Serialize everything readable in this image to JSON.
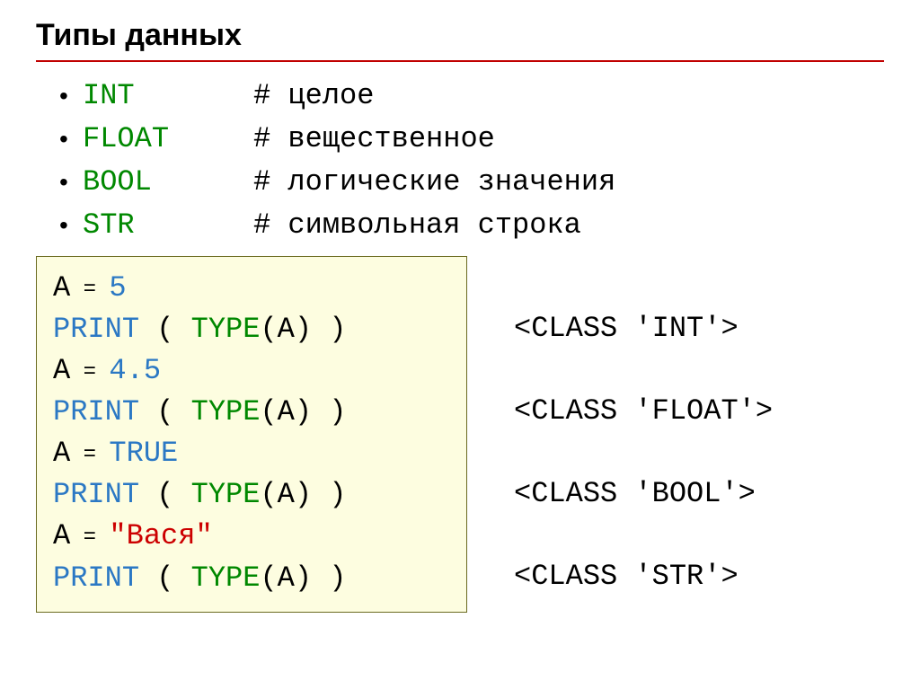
{
  "heading": "Типы данных",
  "types": [
    {
      "name": "INT",
      "comment": "# целое"
    },
    {
      "name": "FLOAT",
      "comment": "# вещественное"
    },
    {
      "name": "BOOL",
      "comment": "# логические значения"
    },
    {
      "name": "STR",
      "comment": "# символьная строка"
    }
  ],
  "code": {
    "assign1_var": "A",
    "assign1_val": "5",
    "print1_call": "PRINT",
    "type_call": "TYPE",
    "arg": "(A)",
    "closeParen": " )",
    "openParen": " ( ",
    "assign2_val": "4.5",
    "assign3_val": "TRUE",
    "assign4_val": "\"Вася\""
  },
  "outputs": {
    "o1": "<CLASS 'INT'>",
    "o2": "<CLASS 'FLOAT'>",
    "o3": "<CLASS 'BOOL'>",
    "o4": "<CLASS 'STR'>"
  }
}
